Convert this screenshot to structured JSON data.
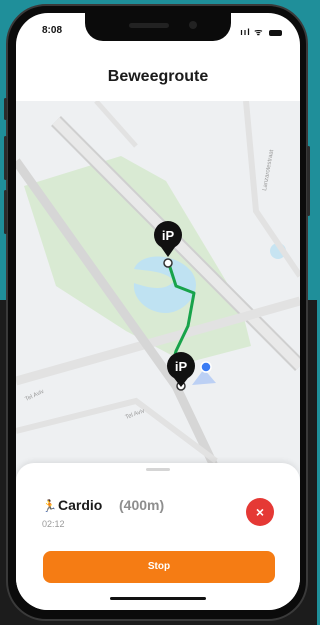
{
  "status_bar": {
    "time": "8:08",
    "icons": "ııl ᯤ"
  },
  "header": {
    "title": "Beweegroute"
  },
  "map": {
    "street_labels": [
      "Lanzarotestraat",
      "Tel Aviv",
      "Tel Aviv"
    ],
    "marker_logo_text": "iP",
    "colors": {
      "park": "#d9ead3",
      "water": "#bfe2f2",
      "route": "#18a34a",
      "road": "#e4e4e4",
      "road_edge": "#cfcfcf"
    }
  },
  "activity": {
    "icon": "running-icon",
    "name": "Cardio",
    "distance": "(400m)",
    "elapsed": "02:12",
    "close_symbol": "×"
  },
  "actions": {
    "stop_label": "Stop"
  },
  "colors": {
    "accent": "#f57c14",
    "danger": "#e53935",
    "background": "#1f8f9a"
  }
}
